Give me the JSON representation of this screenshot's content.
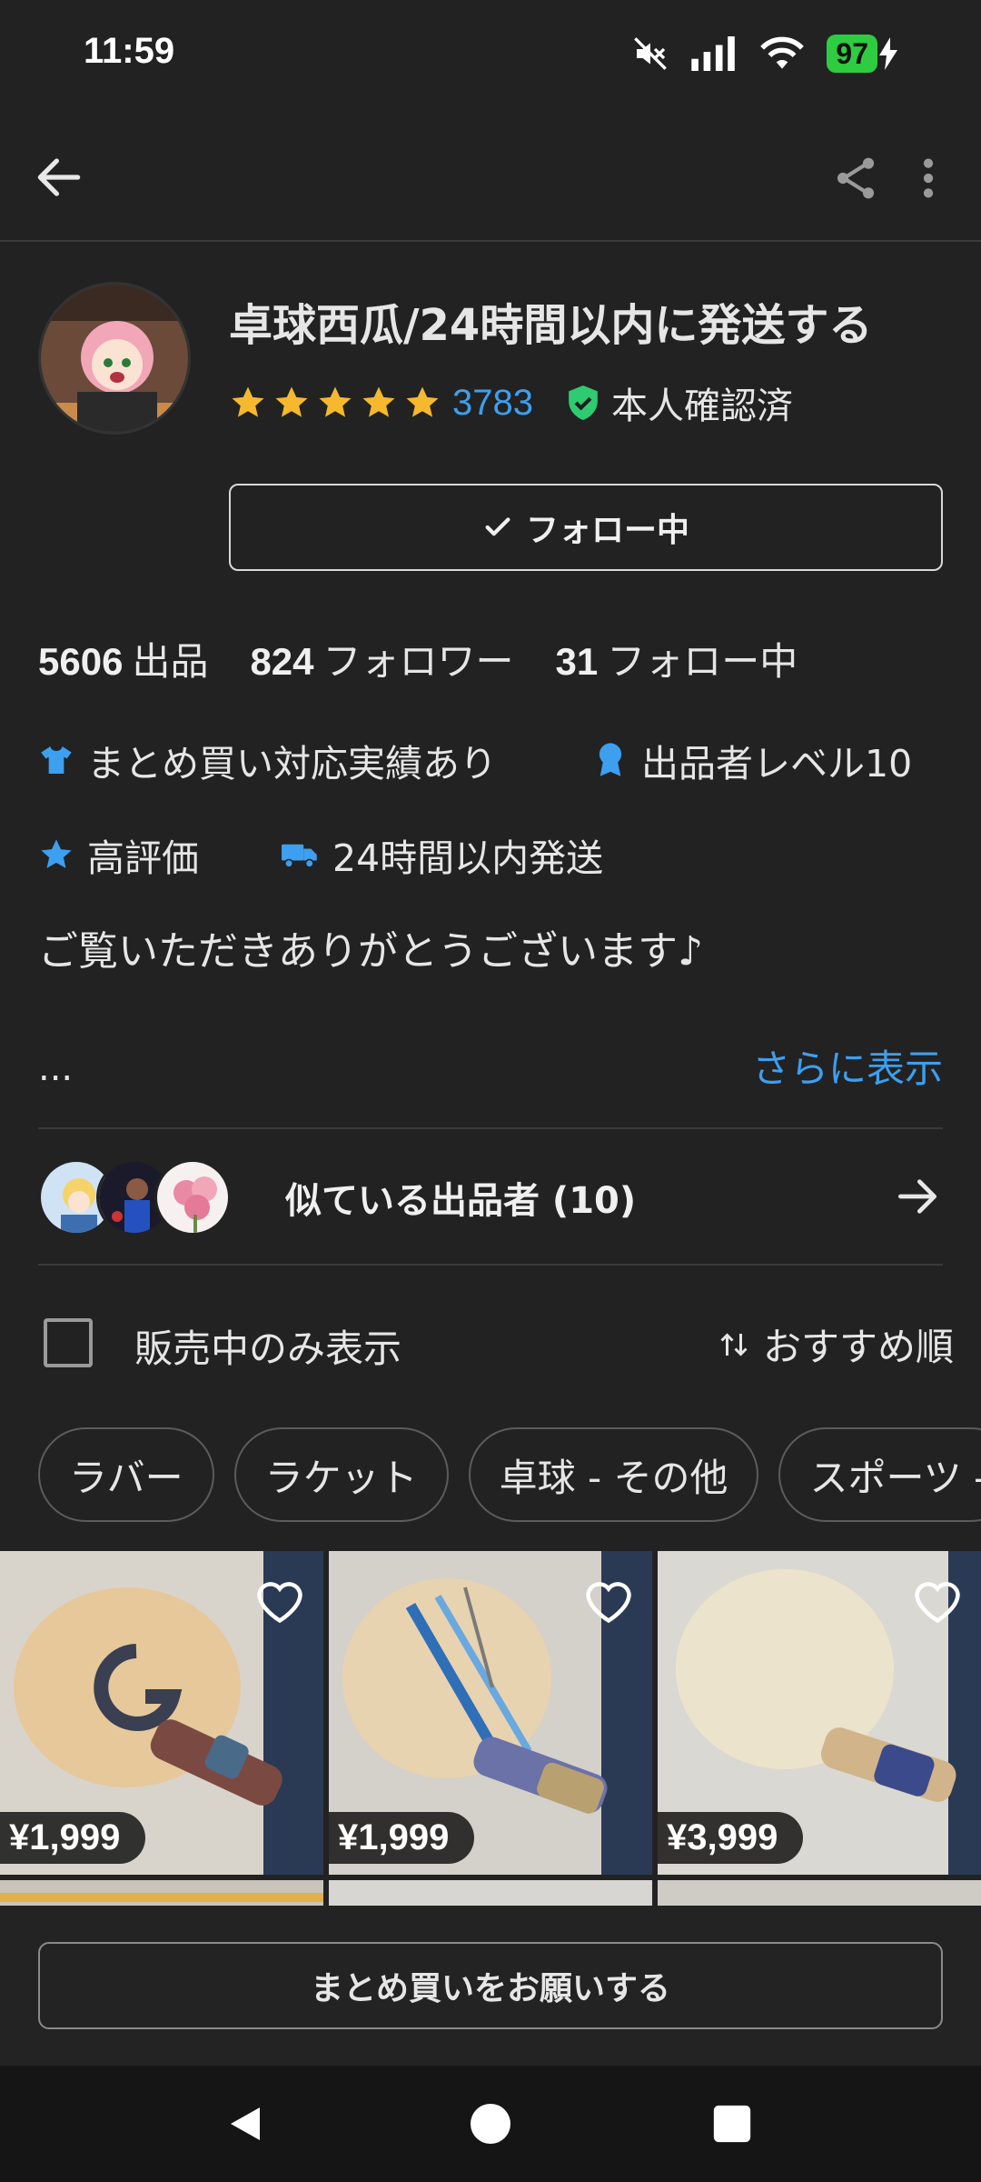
{
  "status_bar": {
    "time": "11:59",
    "battery": "97"
  },
  "profile": {
    "shop_name": "卓球西瓜/24時間以内に発送する",
    "rating_count": "3783",
    "verified_label": "本人確認済",
    "follow_label": "フォロー中"
  },
  "stats": [
    {
      "num": "5606",
      "label": "出品"
    },
    {
      "num": "824",
      "label": "フォロワー"
    },
    {
      "num": "31",
      "label": "フォロー中"
    }
  ],
  "badges": {
    "bulk": "まとめ買い対応実績あり",
    "level": "出品者レベル10",
    "high_rating": "高評価",
    "shipping": "24時間以内発送"
  },
  "bio": "ご覧いただきありがとうございます♪",
  "bio_ellipsis": "...",
  "more_link": "さらに表示",
  "similar_sellers": "似ている出品者 (10)",
  "filter": {
    "on_sale_only": "販売中のみ表示",
    "sort": "おすすめ順"
  },
  "chips": [
    "ラバー",
    "ラケット",
    "卓球 - その他",
    "スポーツ -"
  ],
  "products": [
    {
      "price": "¥1,999"
    },
    {
      "price": "¥1,999"
    },
    {
      "price": "¥3,999"
    }
  ],
  "bulk_button": "まとめ買いをお願いする",
  "colors": {
    "accent_blue": "#3d9ff0",
    "star": "#f5b82e",
    "verified_green": "#2ecc71",
    "battery_green": "#2ecc40"
  }
}
